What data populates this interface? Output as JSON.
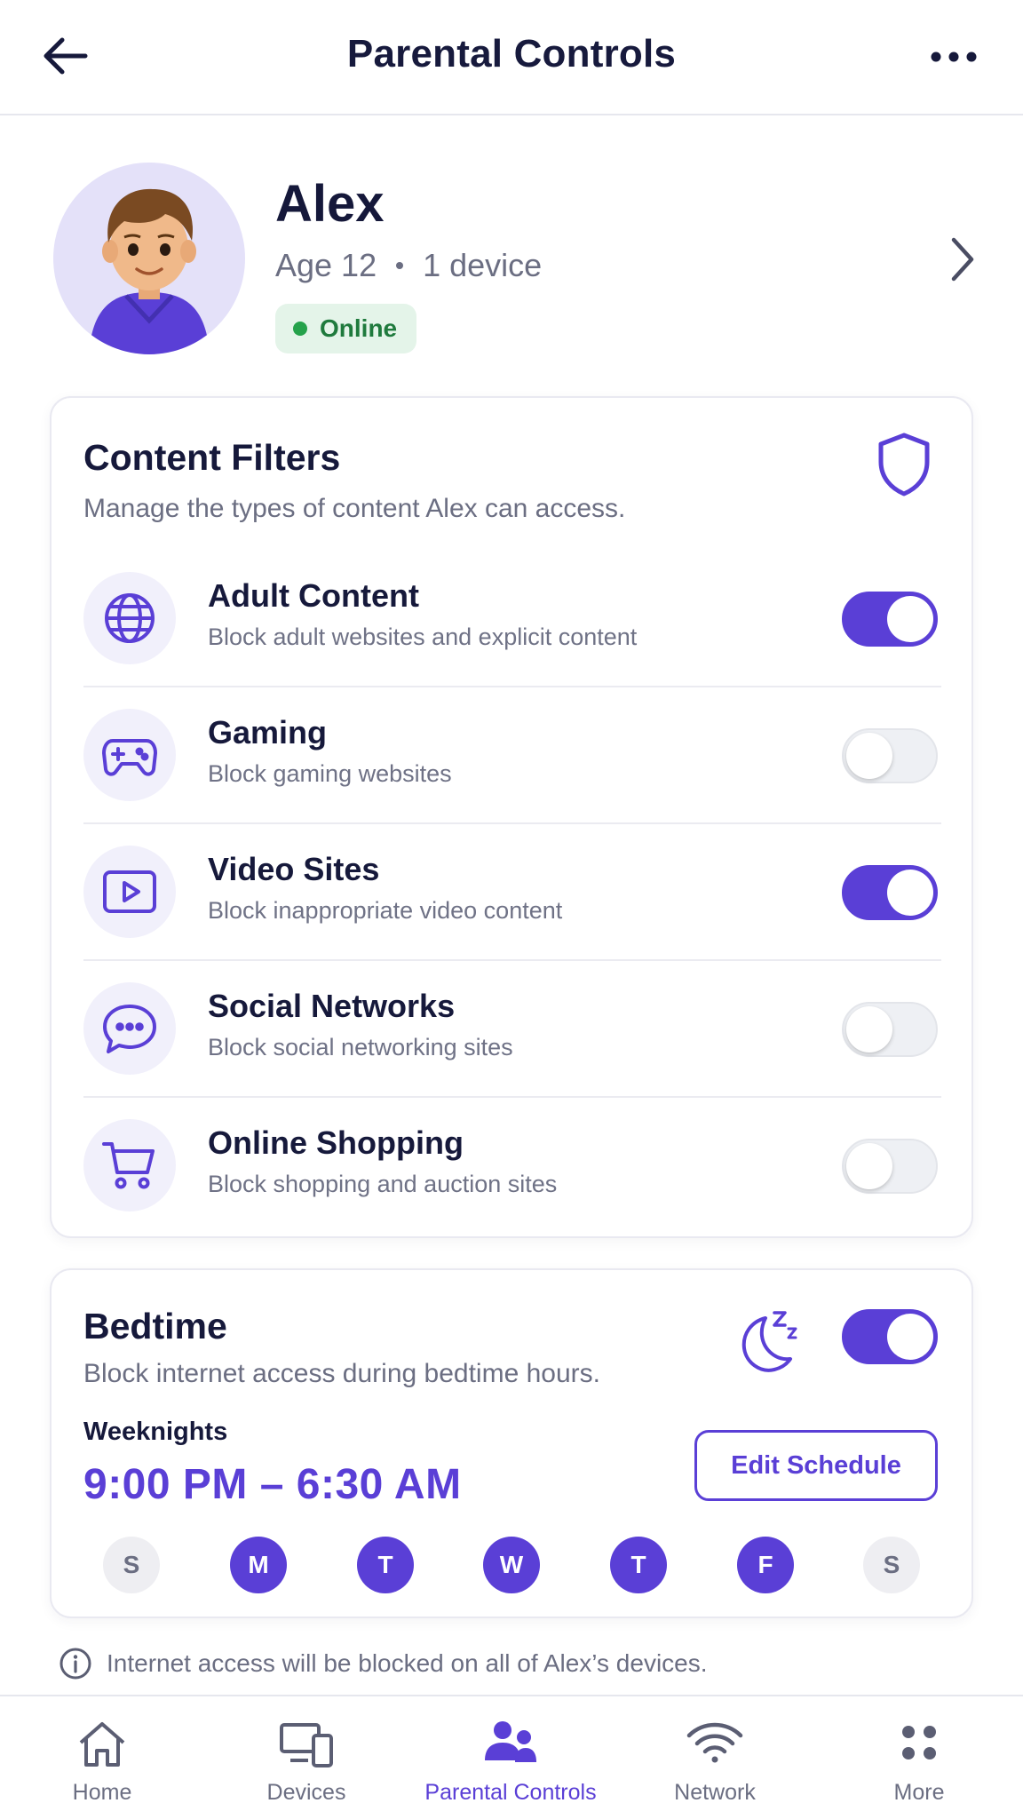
{
  "header": {
    "title": "Parental Controls"
  },
  "profile": {
    "name": "Alex",
    "age": "Age 12",
    "devices": "1 device",
    "status": "Online"
  },
  "content_filters": {
    "title": "Content Filters",
    "subtitle": "Manage the types of content Alex can access.",
    "icon": "shield-icon",
    "items": [
      {
        "icon": "globe-icon",
        "title": "Adult Content",
        "description": "Block adult websites and explicit content",
        "enabled": true
      },
      {
        "icon": "gamepad-icon",
        "title": "Gaming",
        "description": "Block gaming websites",
        "enabled": false
      },
      {
        "icon": "video-play-icon",
        "title": "Video Sites",
        "description": "Block inappropriate video content",
        "enabled": true
      },
      {
        "icon": "chat-bubble-icon",
        "title": "Social Networks",
        "description": "Block social networking sites",
        "enabled": false
      },
      {
        "icon": "shopping-cart-icon",
        "title": "Online Shopping",
        "description": "Block shopping and auction sites",
        "enabled": false
      }
    ]
  },
  "bedtime": {
    "title": "Bedtime",
    "subtitle": "Block internet access during bedtime hours.",
    "enabled": true,
    "schedule_label": "Weeknights",
    "schedule_time": "9:00 PM – 6:30 AM",
    "edit_label": "Edit Schedule",
    "days": [
      {
        "label": "S",
        "active": false
      },
      {
        "label": "M",
        "active": true
      },
      {
        "label": "T",
        "active": true
      },
      {
        "label": "W",
        "active": true
      },
      {
        "label": "T",
        "active": true
      },
      {
        "label": "F",
        "active": true
      },
      {
        "label": "S",
        "active": false
      }
    ]
  },
  "info": {
    "text": "Internet access will be blocked on all of Alex’s devices."
  },
  "nav": {
    "items": [
      {
        "icon": "home-icon",
        "label": "Home",
        "active": false
      },
      {
        "icon": "devices-icon",
        "label": "Devices",
        "active": false
      },
      {
        "icon": "family-icon",
        "label": "Parental Controls",
        "active": true
      },
      {
        "icon": "wifi-icon",
        "label": "Network",
        "active": false
      },
      {
        "icon": "grid-dots-icon",
        "label": "More",
        "active": false
      }
    ]
  },
  "colors": {
    "accent": "#5a3fd6",
    "online": "#25a24b",
    "text": "#16193b",
    "muted": "#6b6e82"
  }
}
